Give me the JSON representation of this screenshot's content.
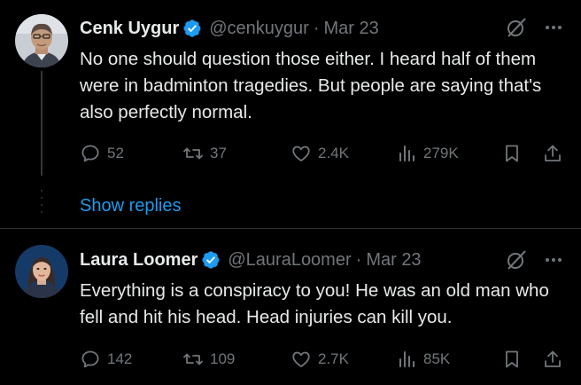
{
  "colors": {
    "background": "#000000",
    "text": "#e7e9ea",
    "muted": "#71767b",
    "accent": "#1d9bf0",
    "divider": "#2f3336"
  },
  "tweets": [
    {
      "name": "Cenk Uygur",
      "handle": "@cenkuygur",
      "separator": "·",
      "date": "Mar 23",
      "verified": true,
      "text": "No one should question those either. I heard half of them were in badminton tragedies. But people are saying that's also perfectly normal.",
      "stats": {
        "replies": "52",
        "reposts": "37",
        "likes": "2.4K",
        "views": "279K"
      },
      "icons": [
        "reply-icon",
        "repost-icon",
        "like-icon",
        "views-icon",
        "bookmark-icon",
        "share-icon",
        "grok-icon",
        "more-icon",
        "verified-badge-icon"
      ]
    },
    {
      "name": "Laura Loomer",
      "handle": "@LauraLoomer",
      "separator": "·",
      "date": "Mar 23",
      "verified": true,
      "text": "Everything is a conspiracy to you! He was an old man who fell and hit his head. Head injuries can kill you.",
      "stats": {
        "replies": "142",
        "reposts": "109",
        "likes": "2.7K",
        "views": "85K"
      },
      "icons": [
        "reply-icon",
        "repost-icon",
        "like-icon",
        "views-icon",
        "bookmark-icon",
        "share-icon",
        "grok-icon",
        "more-icon",
        "verified-badge-icon"
      ]
    }
  ],
  "thread": {
    "show_replies_label": "Show replies"
  }
}
